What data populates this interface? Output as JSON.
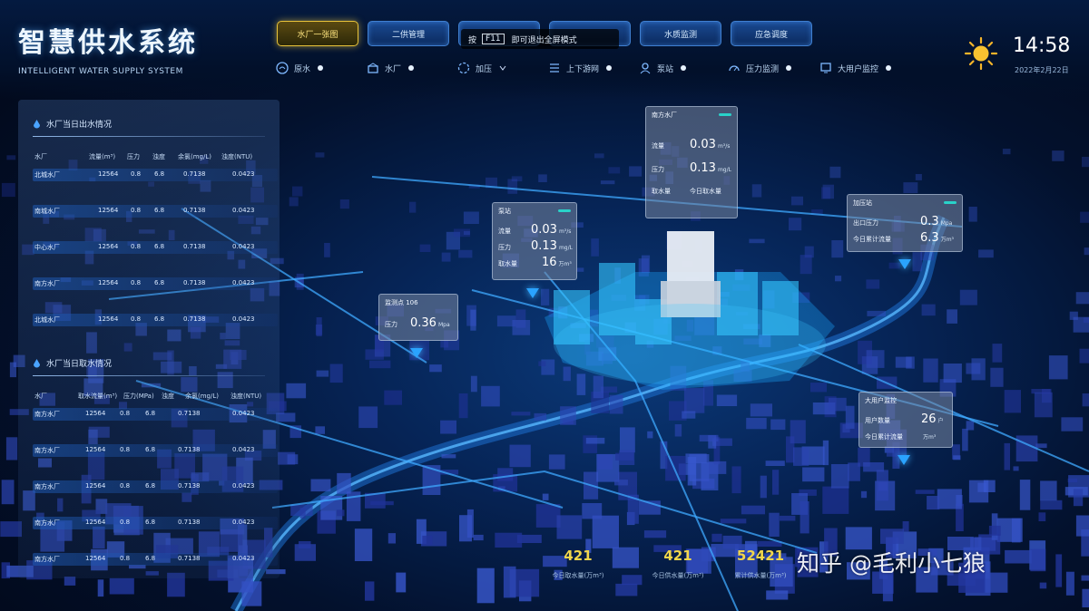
{
  "app": {
    "title": "智慧供水系统",
    "subtitle": "INTELLIGENT WATER SUPPLY SYSTEM"
  },
  "nav": {
    "tabs": [
      {
        "label": "水厂一张图",
        "active": true
      },
      {
        "label": "二供管理",
        "active": false
      },
      {
        "label": "",
        "active": false
      },
      {
        "label": "",
        "active": false
      },
      {
        "label": "水质监测",
        "active": false
      },
      {
        "label": "应急调度",
        "active": false
      }
    ]
  },
  "mode_bar": {
    "key_hint": "按",
    "key": "F11",
    "text": "即可退出全屏模式"
  },
  "toolbar": [
    {
      "label": "原水",
      "icon": "raw-water-icon"
    },
    {
      "label": "水厂",
      "icon": "plant-icon"
    },
    {
      "label": "加压",
      "icon": "pressure-icon"
    },
    {
      "label": "上下游网",
      "icon": "network-icon"
    },
    {
      "label": "泵站",
      "icon": "pump-icon"
    },
    {
      "label": "压力监测",
      "icon": "gauge-icon"
    },
    {
      "label": "大用户监控",
      "icon": "monitor-icon"
    }
  ],
  "weather": {
    "icon": "sun-icon",
    "time": "14:58",
    "date": "2022年2月22日"
  },
  "panel_out": {
    "title": "水厂当日出水情况",
    "headers": [
      "水厂",
      "流量(m³)",
      "压力",
      "浊度",
      "余氯(mg/L)",
      "浊度(NTU)"
    ],
    "rows": [
      [
        "北城水厂",
        "12564",
        "0.8",
        "6.8",
        "0.7138",
        "0.0423"
      ],
      [
        "南城水厂",
        "12564",
        "0.8",
        "6.8",
        "0.7138",
        "0.0423"
      ],
      [
        "中心水厂",
        "12564",
        "0.8",
        "6.8",
        "0.7138",
        "0.0423"
      ],
      [
        "南方水厂",
        "12564",
        "0.8",
        "6.8",
        "0.7138",
        "0.0423"
      ],
      [
        "北城水厂",
        "12564",
        "0.8",
        "6.8",
        "0.7138",
        "0.0423"
      ]
    ]
  },
  "panel_in": {
    "title": "水厂当日取水情况",
    "headers": [
      "水厂",
      "取水流量(m³)",
      "压力(MPa)",
      "浊度",
      "余氯(mg/L)",
      "浊度(NTU)"
    ],
    "rows": [
      [
        "南方水厂",
        "12564",
        "0.8",
        "6.8",
        "0.7138",
        "0.0423"
      ],
      [
        "南方水厂",
        "12564",
        "0.8",
        "6.8",
        "0.7138",
        "0.0423"
      ],
      [
        "南方水厂",
        "12564",
        "0.8",
        "6.8",
        "0.7138",
        "0.0423"
      ],
      [
        "南方水厂",
        "12564",
        "0.8",
        "6.8",
        "0.7138",
        "0.0423"
      ],
      [
        "南方水厂",
        "12564",
        "0.8",
        "6.8",
        "0.7138",
        "0.0423"
      ]
    ]
  },
  "cards": [
    {
      "title": "南方水厂",
      "rows": [
        {
          "label": "流量",
          "value": "0.03",
          "unit": "m³/s"
        },
        {
          "label": "压力",
          "value": "0.13",
          "unit": "mg/L"
        },
        {
          "label": "取水量",
          "value": "今日取水量",
          "unit": ""
        }
      ]
    },
    {
      "title": "泵站",
      "rows": [
        {
          "label": "流量",
          "value": "0.03",
          "unit": "m³/s"
        },
        {
          "label": "压力",
          "value": "0.13",
          "unit": "mg/L"
        },
        {
          "label": "取水量",
          "value": "16",
          "unit": "万m³"
        }
      ]
    },
    {
      "title": "加压站",
      "rows": [
        {
          "label": "出口压力",
          "value": "0.3",
          "unit": "Mpa"
        },
        {
          "label": "今日累计流量",
          "value": "6.3",
          "unit": "万m³"
        }
      ]
    },
    {
      "title": "监测点 106",
      "rows": [
        {
          "label": "压力",
          "value": "0.36",
          "unit": "Mpa"
        }
      ]
    },
    {
      "title": "大用户监控",
      "rows": [
        {
          "label": "用户数量",
          "value": "26",
          "unit": "户"
        },
        {
          "label": "今日累计流量",
          "value": "",
          "unit": "万m³"
        }
      ]
    }
  ],
  "stats": [
    {
      "value": "421",
      "label": "今日取水量(万m³)"
    },
    {
      "value": "421",
      "label": "今日供水量(万m³)"
    },
    {
      "value": "52421",
      "label": "累计供水量(万m³)"
    }
  ],
  "watermark": "知乎 @毛利小七狼"
}
